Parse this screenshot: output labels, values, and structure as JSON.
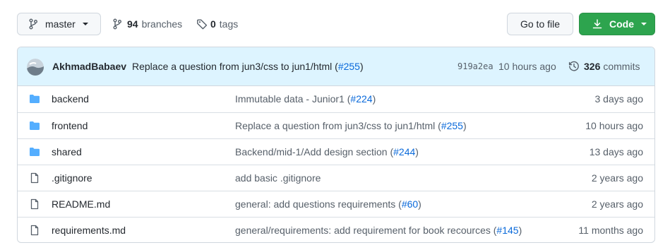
{
  "toolbar": {
    "branch_label": "master",
    "branches_count": "94",
    "branches_label": "branches",
    "tags_count": "0",
    "tags_label": "tags",
    "goto_label": "Go to file",
    "code_label": "Code"
  },
  "colors": {
    "code_button": "#2da44e",
    "commit_bar": "#ddf4ff",
    "folder": "#54aeff",
    "link": "#0969da"
  },
  "latest_commit": {
    "author": "AkhmadBabaev",
    "message": "Replace a question from jun3/css to jun1/html (",
    "pr": "#255",
    "message_end": ")",
    "sha": "919a2ea",
    "time": "10 hours ago",
    "commits_count": "326",
    "commits_label": "commits"
  },
  "files": [
    {
      "type": "folder",
      "icon": "folder-icon",
      "name": "backend",
      "msg": "Immutable data - Junior1 (",
      "pr": "#224",
      "msg_end": ")",
      "age": "3 days ago"
    },
    {
      "type": "folder",
      "icon": "folder-icon",
      "name": "frontend",
      "msg": "Replace a question from jun3/css to jun1/html (",
      "pr": "#255",
      "msg_end": ")",
      "age": "10 hours ago"
    },
    {
      "type": "folder",
      "icon": "folder-icon",
      "name": "shared",
      "msg": "Backend/mid-1/Add design section (",
      "pr": "#244",
      "msg_end": ")",
      "age": "13 days ago"
    },
    {
      "type": "file",
      "icon": "file-icon",
      "name": ".gitignore",
      "msg": "add basic .gitignore",
      "pr": "",
      "msg_end": "",
      "age": "2 years ago"
    },
    {
      "type": "file",
      "icon": "file-icon",
      "name": "README.md",
      "msg": "general: add questions requirements (",
      "pr": "#60",
      "msg_end": ")",
      "age": "2 years ago"
    },
    {
      "type": "file",
      "icon": "file-icon",
      "name": "requirements.md",
      "msg": "general/requirements: add requirement for book recources (",
      "pr": "#145",
      "msg_end": ")",
      "age": "11 months ago"
    }
  ]
}
